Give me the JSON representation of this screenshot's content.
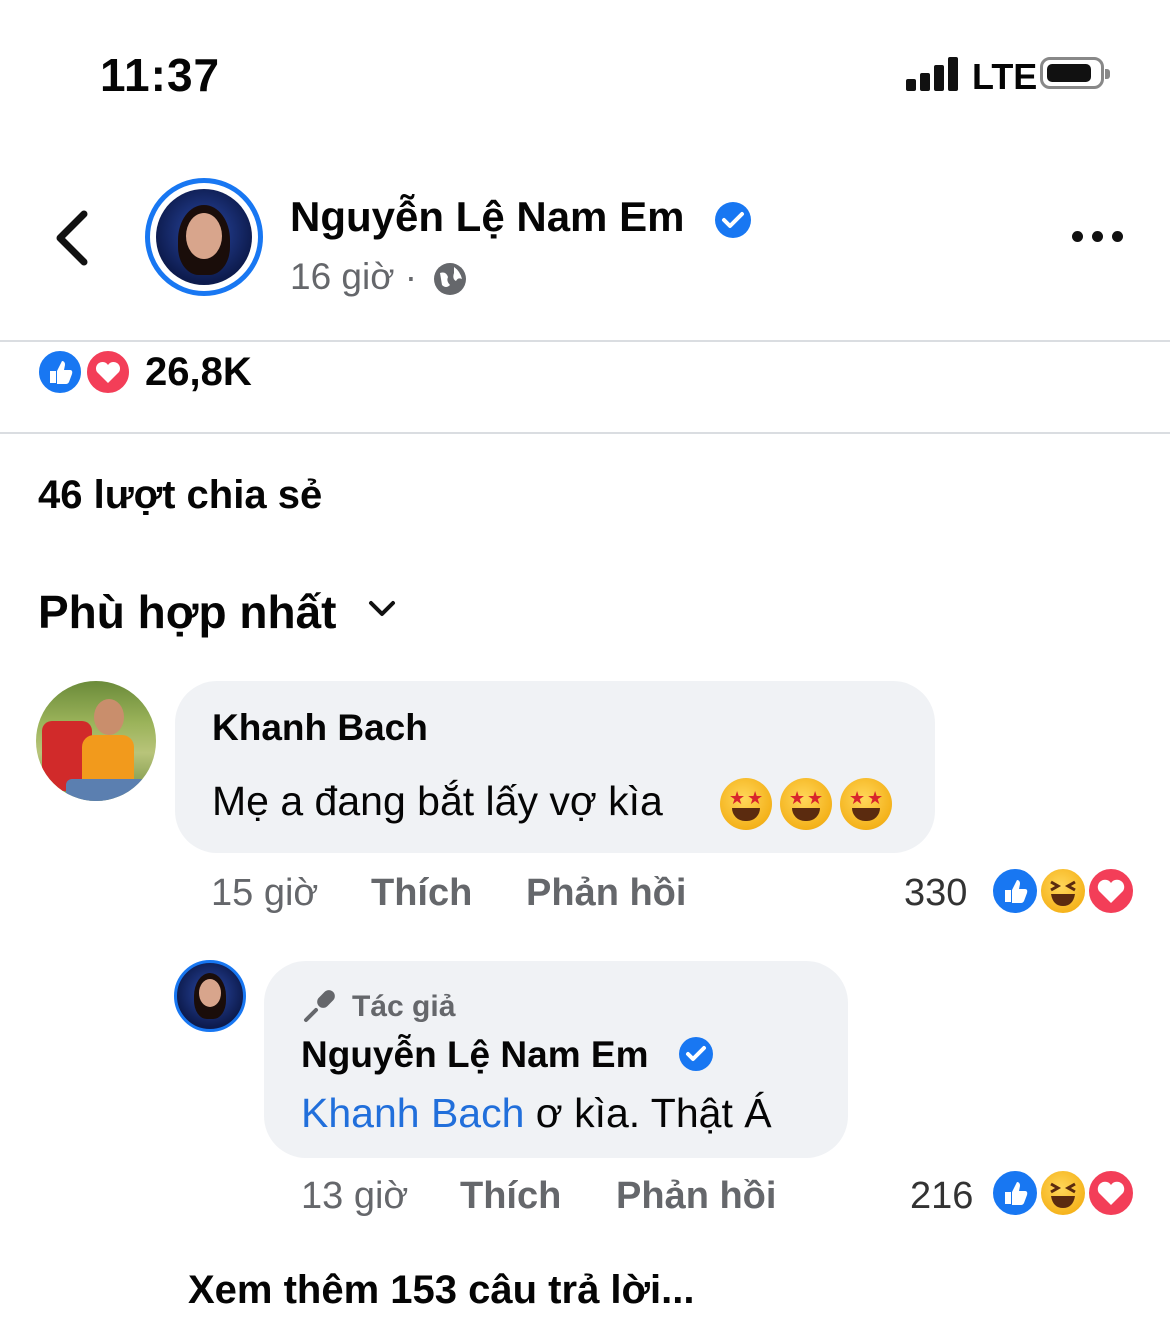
{
  "status_bar": {
    "time": "11:37",
    "carrier": "LTE"
  },
  "post": {
    "author": "Nguyễn Lệ Nam Em",
    "time": "16 giờ",
    "separator": "·",
    "reaction_count": "26,8K",
    "shares": "46 lượt chia sẻ"
  },
  "sort": {
    "label": "Phù hợp nhất"
  },
  "comments": [
    {
      "author": "Khanh Bach",
      "text": "Mẹ a đang bắt lấy vợ kìa",
      "time": "15 giờ",
      "like_label": "Thích",
      "reply_label": "Phản hồi",
      "reaction_count": "330"
    }
  ],
  "reply": {
    "badge": "Tác giả",
    "author": "Nguyễn Lệ Nam Em",
    "mention": "Khanh Bach",
    "text": " ơ kìa. Thật Á",
    "time": "13 giờ",
    "like_label": "Thích",
    "reply_label": "Phản hồi",
    "reaction_count": "216"
  },
  "more_replies": "Xem thêm 153 câu trả lời...",
  "colors": {
    "accent": "#1877f2",
    "love": "#f33e58",
    "mention": "#216fdb",
    "muted": "#65676b"
  },
  "icons": [
    "back-arrow-icon",
    "verified-badge-icon",
    "globe-icon",
    "more-options-icon",
    "like-reaction-icon",
    "love-reaction-icon",
    "haha-reaction-icon",
    "star-struck-emoji-icon",
    "chevron-down-icon",
    "microphone-icon"
  ]
}
